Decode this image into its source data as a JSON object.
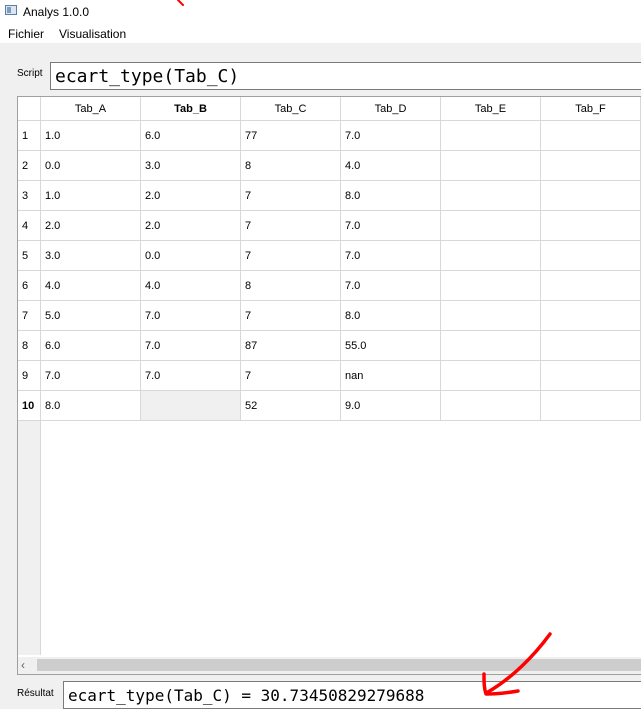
{
  "window": {
    "title": "Analys 1.0.0"
  },
  "menu": {
    "items": [
      "Fichier",
      "Visualisation"
    ]
  },
  "script": {
    "label": "Script",
    "value": "ecart_type(Tab_C)"
  },
  "table": {
    "columns": [
      "Tab_A",
      "Tab_B",
      "Tab_C",
      "Tab_D",
      "Tab_E",
      "Tab_F"
    ],
    "rows": [
      {
        "id": "1",
        "cells": [
          "1.0",
          "6.0",
          "77",
          "7.0",
          "",
          ""
        ]
      },
      {
        "id": "2",
        "cells": [
          "0.0",
          "3.0",
          "8",
          "4.0",
          "",
          ""
        ]
      },
      {
        "id": "3",
        "cells": [
          "1.0",
          "2.0",
          "7",
          "8.0",
          "",
          ""
        ]
      },
      {
        "id": "4",
        "cells": [
          "2.0",
          "2.0",
          "7",
          "7.0",
          "",
          ""
        ]
      },
      {
        "id": "5",
        "cells": [
          "3.0",
          "0.0",
          "7",
          "7.0",
          "",
          ""
        ]
      },
      {
        "id": "6",
        "cells": [
          "4.0",
          "4.0",
          "8",
          "7.0",
          "",
          ""
        ]
      },
      {
        "id": "7",
        "cells": [
          "5.0",
          "7.0",
          "7",
          "8.0",
          "",
          ""
        ]
      },
      {
        "id": "8",
        "cells": [
          "6.0",
          "7.0",
          "87",
          "55.0",
          "",
          ""
        ]
      },
      {
        "id": "9",
        "cells": [
          "7.0",
          "7.0",
          "7",
          "nan",
          "",
          ""
        ]
      },
      {
        "id": "10",
        "cells": [
          "8.0",
          "",
          "52",
          "9.0",
          "",
          ""
        ]
      }
    ]
  },
  "result": {
    "label": "Résultat",
    "value": "ecart_type(Tab_C) = 30.73450829279688"
  },
  "annotation": {
    "color": "#ff0000"
  }
}
